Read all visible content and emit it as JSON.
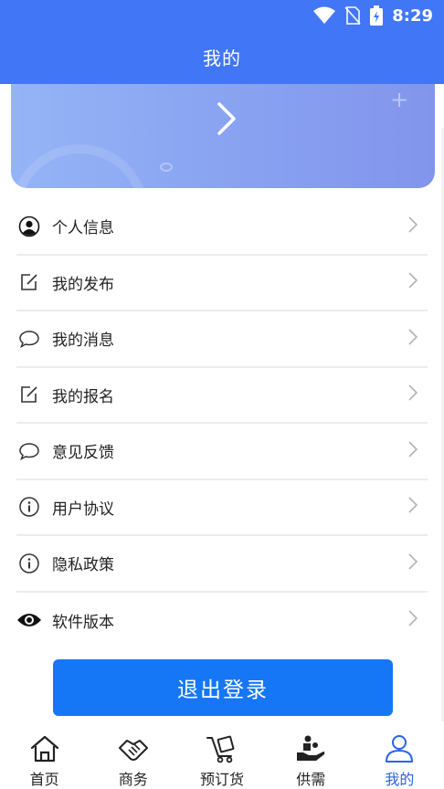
{
  "status_bar": {
    "time": "8:29"
  },
  "header": {
    "title": "我的"
  },
  "menu": [
    {
      "label": "个人信息",
      "icon": "person-icon"
    },
    {
      "label": "我的发布",
      "icon": "edit-icon"
    },
    {
      "label": "我的消息",
      "icon": "chat-bubble-icon"
    },
    {
      "label": "我的报名",
      "icon": "edit-icon"
    },
    {
      "label": "意见反馈",
      "icon": "chat-bubble-icon"
    },
    {
      "label": "用户协议",
      "icon": "info-icon"
    },
    {
      "label": "隐私政策",
      "icon": "info-icon"
    },
    {
      "label": "软件版本",
      "icon": "eye-icon"
    }
  ],
  "logout": {
    "label": "退出登录"
  },
  "tabbar": {
    "active": 4,
    "tabs": [
      {
        "label": "首页",
        "icon": "home-icon"
      },
      {
        "label": "商务",
        "icon": "handshake-icon"
      },
      {
        "label": "预订货",
        "icon": "cart-icon"
      },
      {
        "label": "供需",
        "icon": "supply-hand-icon"
      },
      {
        "label": "我的",
        "icon": "user-icon"
      }
    ]
  },
  "colors": {
    "primary": "#4177F6",
    "button": "#1677F6",
    "active_tab": "#2A63E8"
  }
}
